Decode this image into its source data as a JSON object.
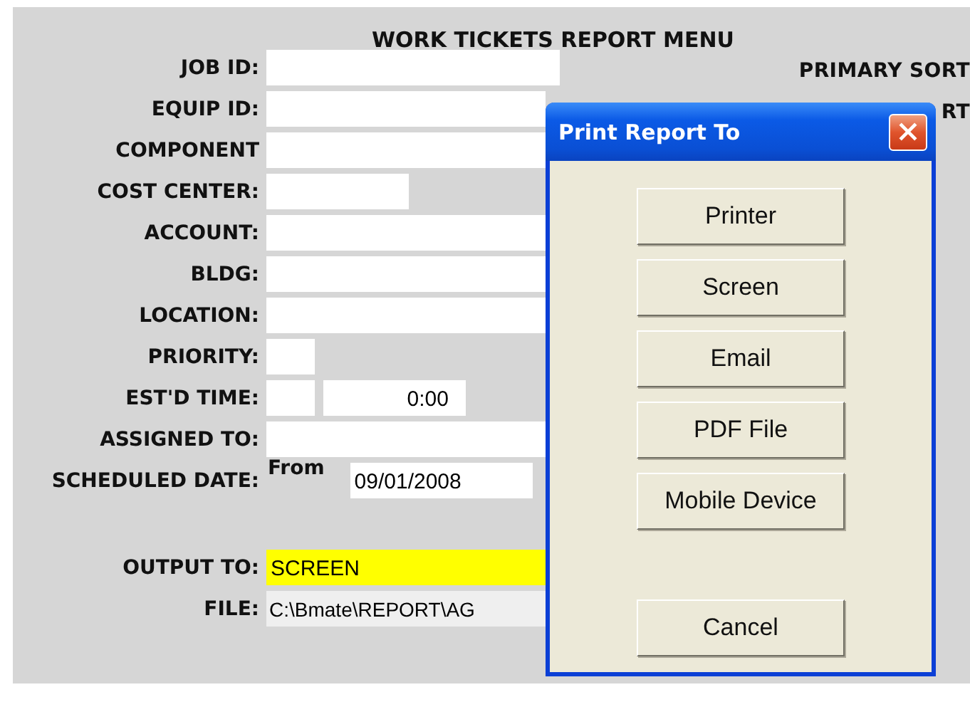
{
  "form": {
    "title": "WORK TICKETS REPORT MENU",
    "sort_labels": [
      "PRIMARY SORT",
      "RT"
    ],
    "fields": [
      {
        "label": "JOB ID:",
        "inputs": [
          {
            "kind": "full"
          }
        ]
      },
      {
        "label": "EQUIP ID:",
        "inputs": [
          {
            "kind": "wide"
          }
        ]
      },
      {
        "label": "COMPONENT",
        "inputs": [
          {
            "kind": "wide"
          }
        ]
      },
      {
        "label": "COST CENTER:",
        "inputs": [
          {
            "kind": "medium"
          }
        ]
      },
      {
        "label": "ACCOUNT:",
        "inputs": [
          {
            "kind": "wide"
          }
        ]
      },
      {
        "label": "BLDG:",
        "inputs": [
          {
            "kind": "wide"
          }
        ]
      },
      {
        "label": "LOCATION:",
        "inputs": [
          {
            "kind": "wide"
          }
        ]
      },
      {
        "label": "PRIORITY:",
        "inputs": [
          {
            "kind": "tiny"
          }
        ]
      },
      {
        "label": "EST'D TIME:",
        "inputs": [
          {
            "kind": "tiny"
          },
          {
            "kind": "time",
            "value": "0:00"
          }
        ]
      },
      {
        "label": "ASSIGNED TO:",
        "inputs": [
          {
            "kind": "wide"
          }
        ]
      },
      {
        "label": "SCHEDULED DATE:",
        "prefix": "From",
        "inputs": [
          {
            "kind": "date",
            "value": "09/01/2008"
          }
        ]
      },
      {
        "kind": "gap"
      },
      {
        "label": "OUTPUT TO:",
        "inputs": [
          {
            "kind": "wide",
            "value": "SCREEN",
            "highlighted": true
          }
        ]
      },
      {
        "label": "FILE:",
        "inputs": [
          {
            "kind": "readonly",
            "value": "C:\\Bmate\\REPORT\\AG"
          }
        ]
      }
    ]
  },
  "dialog": {
    "title": "Print Report To",
    "buttons": [
      {
        "label": "Printer"
      },
      {
        "label": "Screen"
      },
      {
        "label": "Email"
      },
      {
        "label": "PDF File"
      },
      {
        "label": "Mobile Device"
      },
      {
        "kind": "spacer"
      },
      {
        "label": "Cancel"
      }
    ]
  }
}
